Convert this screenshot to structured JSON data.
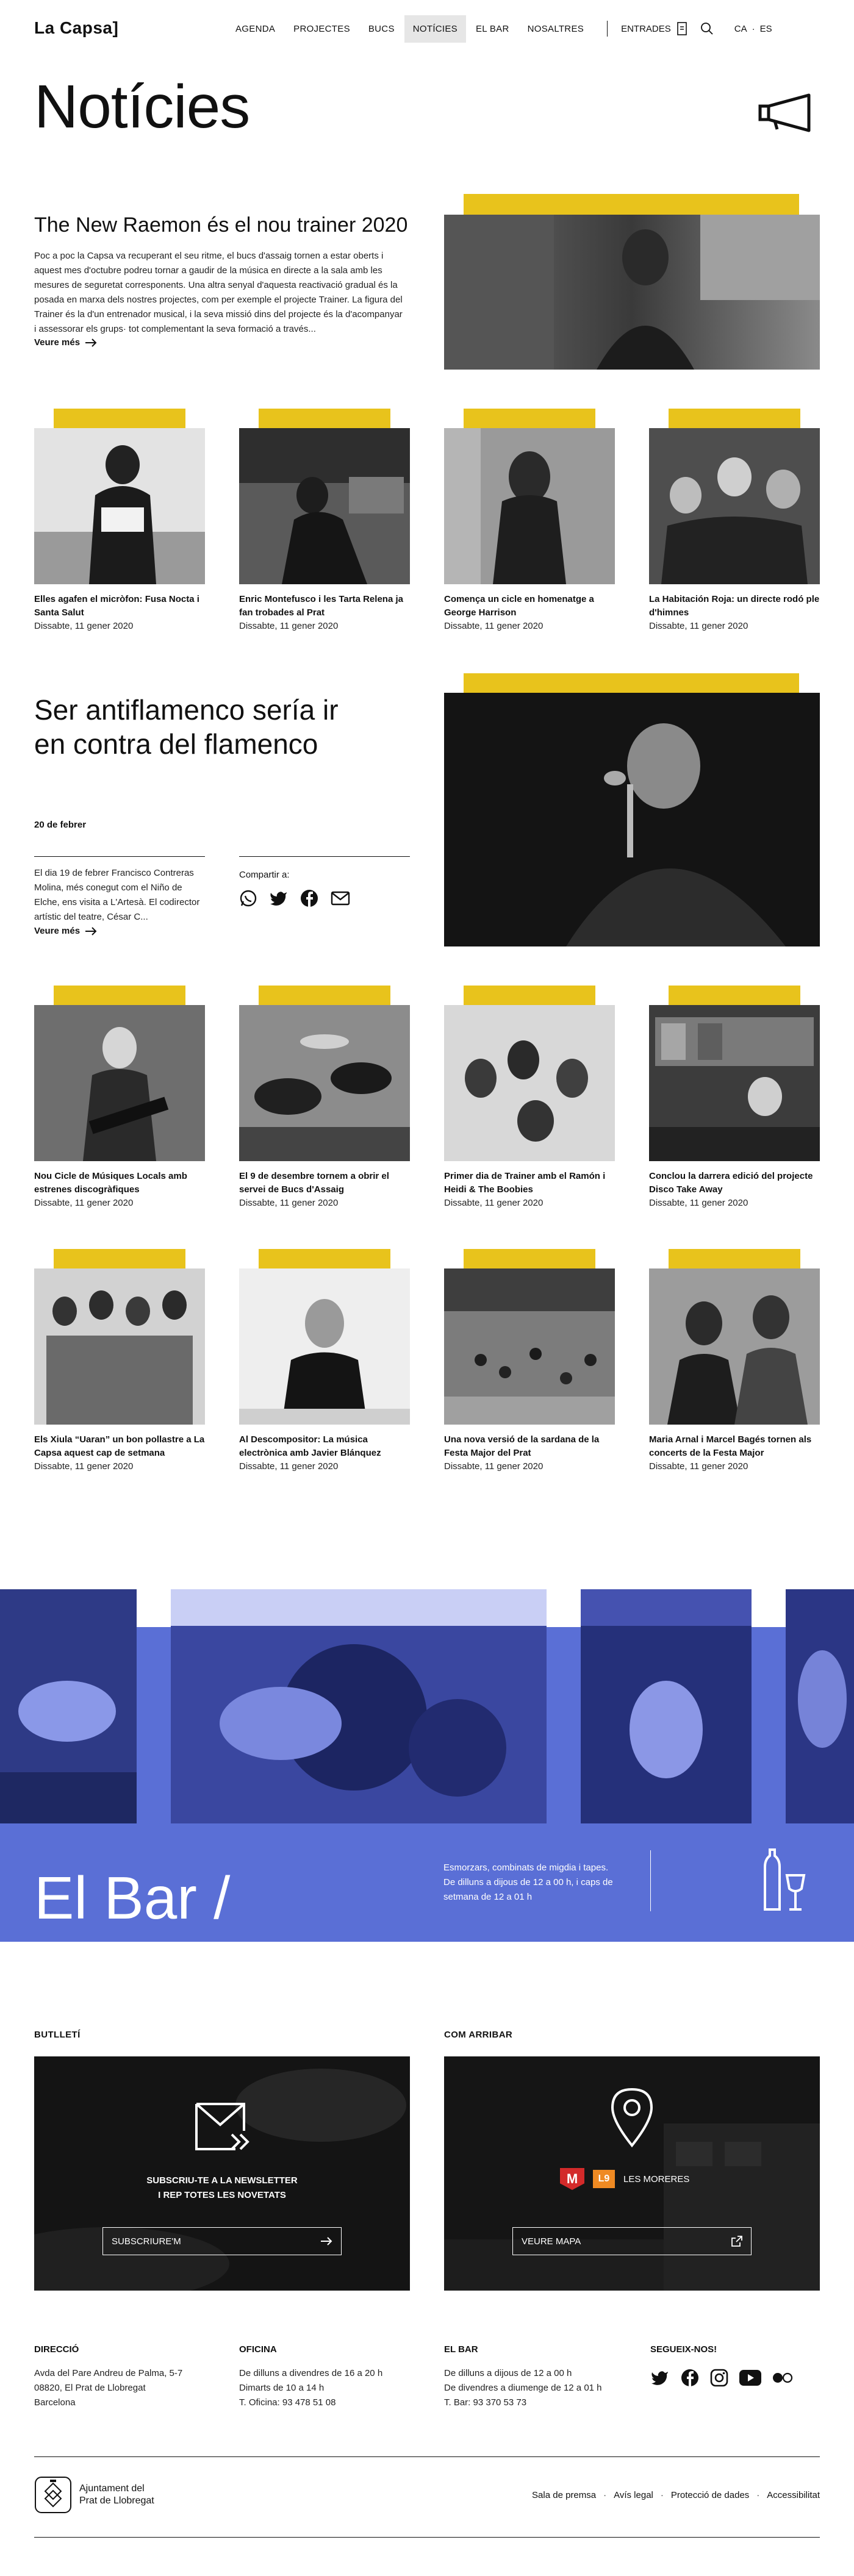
{
  "header": {
    "logo": "La Capsa]",
    "nav": [
      "AGENDA",
      "PROJECTES",
      "BUCS",
      "NOTÍCIES",
      "EL BAR",
      "NOSALTRES"
    ],
    "active_nav": "NOTÍCIES",
    "tickets": "ENTRADES",
    "lang_ca": "CA",
    "lang_sep": "·",
    "lang_es": "ES"
  },
  "page": {
    "title": "Notícies"
  },
  "featured": {
    "title": "The New Raemon és el nou trainer 2020",
    "text": "Poc a poc la Capsa va recuperant el seu ritme, el bucs d'assaig tornen a estar oberts i aquest mes d'octubre podreu tornar a gaudir de la música en directe a la sala amb les mesures de seguretat corresponents. Una altra senyal d'aquesta reactivació gradual és la posada en marxa dels nostres projectes, com per exemple el projecte Trainer. La figura del Trainer és la d'un entrenador musical, i la seva missió dins del projecte és la d'acompanyar i assessorar els grups· tot complementant la seva formació a través...",
    "more": "Veure més"
  },
  "cards_row1": [
    {
      "title": "Elles agafen el micròfon: Fusa Nocta i Santa Salut",
      "date": "Dissabte, 11 gener 2020"
    },
    {
      "title": "Enric Montefusco i les Tarta Relena ja fan trobades al Prat",
      "date": "Dissabte, 11 gener 2020"
    },
    {
      "title": "Comença un cicle en homenatge a George Harrison",
      "date": "Dissabte, 11 gener 2020"
    },
    {
      "title": "La Habitación Roja: un directe rodó ple d'himnes",
      "date": "Dissabte, 11 gener 2020"
    }
  ],
  "feature2": {
    "title": "Ser antiflamenco sería ir en contra del flamenco",
    "date": "20 de febrer",
    "text": "El dia 19 de febrer Francisco Contreras Molina, més conegut com el Niño de Elche, ens visita a L'Artesà. El codirector artístic del teatre, César C...",
    "more": "Veure més",
    "share_label": "Compartir a:"
  },
  "cards_row2": [
    {
      "title": "Nou Cicle de Músiques Locals amb estrenes discogràfiques",
      "date": "Dissabte, 11 gener 2020"
    },
    {
      "title": "El 9 de desembre tornem a obrir el servei de Bucs d'Assaig",
      "date": "Dissabte, 11 gener 2020"
    },
    {
      "title": "Primer dia de Trainer amb el Ramón i Heidi & The Boobies",
      "date": "Dissabte, 11 gener 2020"
    },
    {
      "title": "Conclou la darrera edició del projecte Disco Take Away",
      "date": "Dissabte, 11 gener 2020"
    }
  ],
  "cards_row3": [
    {
      "title": "Els Xiula “Uaran” un bon pollastre a La Capsa aquest cap de setmana",
      "date": "Dissabte, 11 gener 2020"
    },
    {
      "title": "Al Descompositor: La música electrònica amb Javier Blánquez",
      "date": "Dissabte, 11 gener 2020"
    },
    {
      "title": "Una nova versió de la sardana de la Festa Major del Prat",
      "date": "Dissabte, 11 gener 2020"
    },
    {
      "title": "Maria Arnal i Marcel Bagés tornen als concerts de la Festa Major",
      "date": "Dissabte, 11 gener 2020"
    }
  ],
  "bar": {
    "title": "El Bar /",
    "text": "Esmorzars, combinats de migdia i tapes. De dilluns a dijous de 12 a 00 h, i caps de setmana de 12 a 01 h"
  },
  "newsletter": {
    "label": "BUTLLETÍ",
    "text1": "SUBSCRIU-TE A LA NEWSLETTER",
    "text2": "I REP TOTES LES NOVETATS",
    "button": "SUBSCRIURE'M"
  },
  "arrival": {
    "label": "COM ARRIBAR",
    "metro": "M",
    "line": "L9",
    "station": "LES MORERES",
    "button": "VEURE MAPA"
  },
  "footer": {
    "address": {
      "head": "DIRECCIÓ",
      "lines": [
        "Avda del Pare Andreu de Palma, 5-7",
        "08820, El Prat de Llobregat",
        "Barcelona"
      ]
    },
    "office": {
      "head": "OFICINA",
      "lines": [
        "De dilluns a divendres de 16 a 20 h",
        "Dimarts de 10 a 14 h",
        "T. Oficina: 93 478 51 08"
      ]
    },
    "bar": {
      "head": "EL BAR",
      "lines": [
        "De dilluns a dijous de 12 a 00 h",
        "De divendres a diumenge de 12 a 01 h",
        "T. Bar: 93 370 53 73"
      ]
    },
    "follow": {
      "head": "SEGUEIX-NOS!"
    },
    "ajuntament": [
      "Ajuntament del",
      "Prat de Llobregat"
    ],
    "legal": [
      "Sala de premsa",
      "Avís legal",
      "Protecció de dades",
      "Accessibilitat"
    ],
    "legal_sep": "·"
  },
  "colors": {
    "accent_yellow": "#e8c31c",
    "bar_blue": "#5a6fd6",
    "dark_panel": "#141414"
  }
}
